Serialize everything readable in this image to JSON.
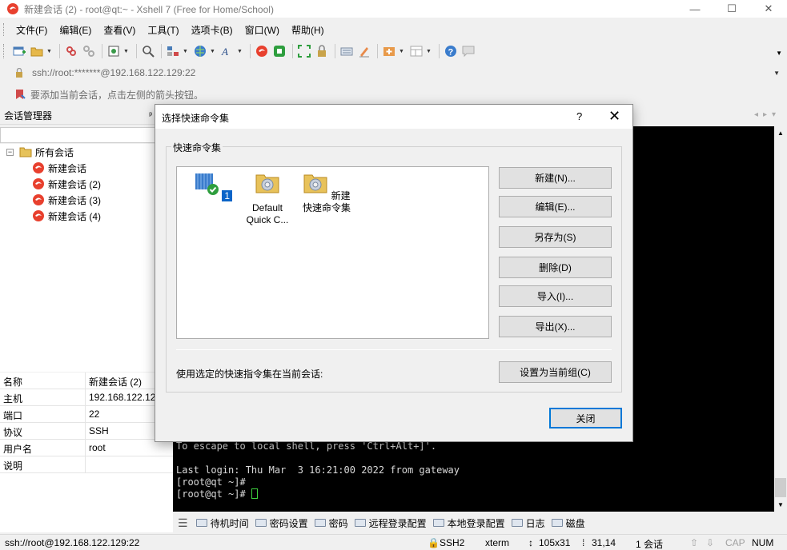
{
  "window": {
    "title": "新建会话 (2) - root@qt:~ - Xshell 7 (Free for Home/School)",
    "minimize": "—",
    "maximize": "☐",
    "close": "✕"
  },
  "menu": [
    "文件(F)",
    "编辑(E)",
    "查看(V)",
    "工具(T)",
    "选项卡(B)",
    "窗口(W)",
    "帮助(H)"
  ],
  "address": {
    "value": "ssh://root:*******@192.168.122.129:22"
  },
  "hint": {
    "text": "要添加当前会话，点击左侧的箭头按钮。"
  },
  "session_manager": {
    "title": "会话管理器",
    "pin": "ᵖ",
    "tree": [
      {
        "label": "所有会话"
      },
      {
        "label": "新建会话"
      },
      {
        "label": "新建会话 (2)"
      },
      {
        "label": "新建会话 (3)"
      },
      {
        "label": "新建会话 (4)"
      }
    ],
    "properties": [
      {
        "key": "名称",
        "value": "新建会话 (2)"
      },
      {
        "key": "主机",
        "value": "192.168.122.129"
      },
      {
        "key": "端口",
        "value": "22"
      },
      {
        "key": "协议",
        "value": "SSH"
      },
      {
        "key": "用户名",
        "value": "root"
      },
      {
        "key": "说明",
        "value": ""
      }
    ]
  },
  "terminal": {
    "lines": [
      "To escape to local shell, press 'Ctrl+Alt+]'.",
      "",
      "Last login: Thu Mar  3 16:21:00 2022 from gateway",
      "[root@qt ~]#",
      "[root@qt ~]# "
    ]
  },
  "quickbar": {
    "items": [
      "待机时间",
      "密码设置",
      "密码",
      "远程登录配置",
      "本地登录配置",
      "日志",
      "磁盘"
    ]
  },
  "status": {
    "connection": "ssh://root@192.168.122.129:22",
    "protocol": "SSH2",
    "term": "xterm",
    "size": "105x31",
    "cursor": "31,14",
    "sessions": "1 会话",
    "cap": "CAP",
    "num": "NUM"
  },
  "dialog": {
    "title": "选择快速命令集",
    "help": "?",
    "close": "✕",
    "group_label": "快速命令集",
    "items": [
      {
        "label": "1",
        "selected": true
      },
      {
        "label": "Default Quick C...",
        "selected": false
      },
      {
        "label": "新建快速命令集",
        "selected": false
      }
    ],
    "buttons": {
      "new": "新建(N)...",
      "edit": "编辑(E)...",
      "save_as": "另存为(S)",
      "delete": "删除(D)",
      "import": "导入(I)...",
      "export": "导出(X)..."
    },
    "apply_label": "使用选定的快速指令集在当前会话:",
    "set_current": "设置为当前组(C)",
    "close_button": "关闭"
  },
  "colors": {
    "terminal_bg": "#000000",
    "cursor": "#3ed13e",
    "selection": "#0a64c8",
    "accent": "#0078d7"
  }
}
